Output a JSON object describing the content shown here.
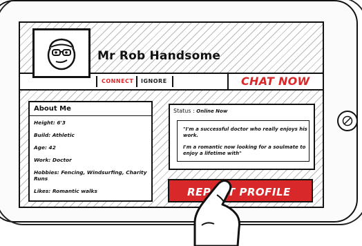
{
  "profile": {
    "name": "Mr Rob Handsome"
  },
  "actions": {
    "connect_label": "CONNECT",
    "ignore_label": "IGNORE",
    "chat_label": "CHAT NOW",
    "report_label": "REPORT PROFILE"
  },
  "about": {
    "title": "About Me",
    "items": [
      "Height: 6'3",
      "Build: Athletic",
      "Age: 42",
      "Work: Doctor",
      "Hobbies: Fencing, Windsurfing, Charity Runs",
      "Likes: Romantic walks"
    ]
  },
  "status": {
    "label": "Status :",
    "value": "Online Now",
    "quote_line1": "\"I'm a successful doctor who really enjoys his work.",
    "quote_line2": "I'm a romantic now looking for a soulmate to enjoy a lifetime with\""
  },
  "colors": {
    "accent_red": "#d8282a",
    "ink": "#111111"
  },
  "icons": {
    "avatar": "cartoon-face-with-glasses-icon",
    "home_button": "circle-slash-icon",
    "finger": "pointing-finger-illustration"
  }
}
